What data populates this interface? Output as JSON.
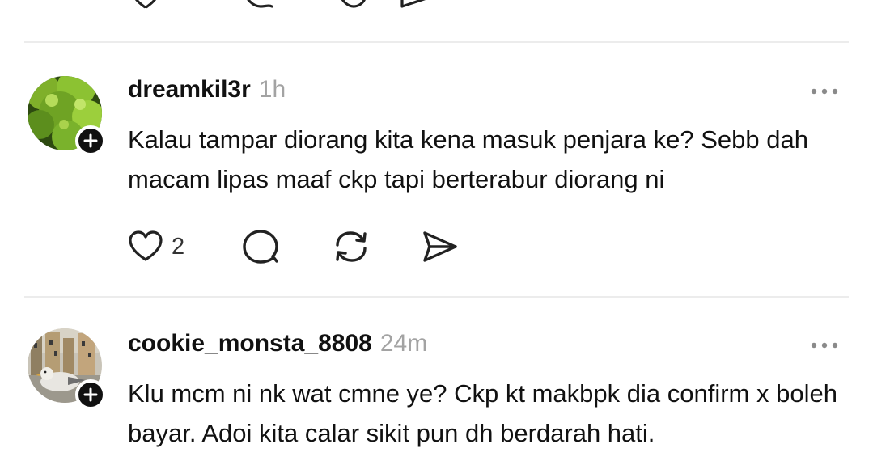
{
  "posts": [
    {
      "username": "dreamkil3r",
      "time": "1h",
      "text": "Kalau tampar diorang kita kena masuk penjara ke? Sebb dah macam lipas maaf ckp tapi berterabur diorang ni",
      "like_count": "2"
    },
    {
      "username": "cookie_monsta_8808",
      "time": "24m",
      "text": "Klu mcm ni nk wat cmne ye? Ckp kt makbpk dia confirm x boleh bayar. Adoi kita calar sikit pun dh berdarah hati."
    }
  ],
  "colors": {
    "text": "#111111",
    "muted": "#a3a3a3",
    "divider": "#ececec"
  }
}
